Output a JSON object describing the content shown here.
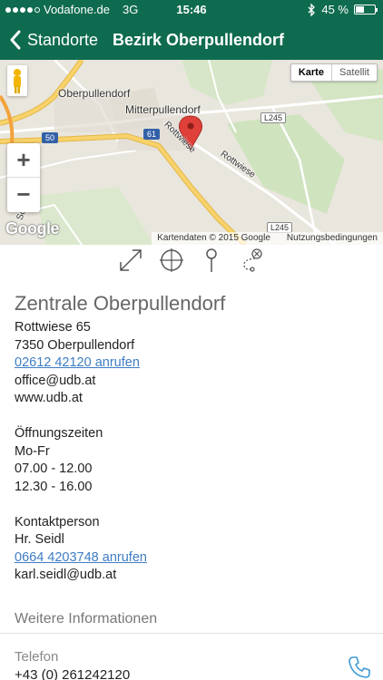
{
  "statusbar": {
    "carrier": "Vodafone.de",
    "network": "3G",
    "time": "15:46",
    "battery_percent": 45,
    "battery_label": "45 %",
    "signal_bars": 4,
    "signal_max": 5
  },
  "navbar": {
    "back_label": "Standorte",
    "title": "Bezirk Oberpullendorf"
  },
  "map": {
    "map_type_options": [
      "Karte",
      "Satellit"
    ],
    "selected_map_type": "Karte",
    "place_labels": [
      "Oberpullendorf",
      "Mitterpullendorf",
      "Rottwiese",
      "Rottwiese",
      "Sonn"
    ],
    "road_badges": [
      "50",
      "61",
      "L245",
      "L245"
    ],
    "zoom_in": "+",
    "zoom_out": "−",
    "logo_text": "Google",
    "attribution": "Kartendaten © 2015 Google",
    "terms": "Nutzungsbedingungen",
    "colors": {
      "road_major": "#f8d26a",
      "park": "#cfe3bf",
      "pin": "#e0403a"
    }
  },
  "tools": [
    "expand-icon",
    "crosshair-icon",
    "pin-icon",
    "route-icon"
  ],
  "location": {
    "name": "Zentrale Oberpullendorf",
    "street": "Rottwiese 65",
    "city": "7350 Oberpullendorf",
    "phone_call": "02612 42120 anrufen",
    "email": "office@udb.at",
    "web": "www.udb.at",
    "hours_label": "Öffnungszeiten",
    "hours_days": "Mo-Fr",
    "hours_1": "07.00 - 12.00",
    "hours_2": "12.30 - 16.00",
    "contact_label": "Kontaktperson",
    "contact_name": "Hr. Seidl",
    "contact_phone_call": "0664 4203748 anrufen",
    "contact_email": "karl.seidl@udb.at"
  },
  "more_info": {
    "header": "Weitere Informationen",
    "phone_label": "Telefon",
    "phone_value": "+43 (0) 261242120"
  },
  "theme": {
    "brand": "#0f6b4f",
    "link": "#3e7cc4"
  }
}
